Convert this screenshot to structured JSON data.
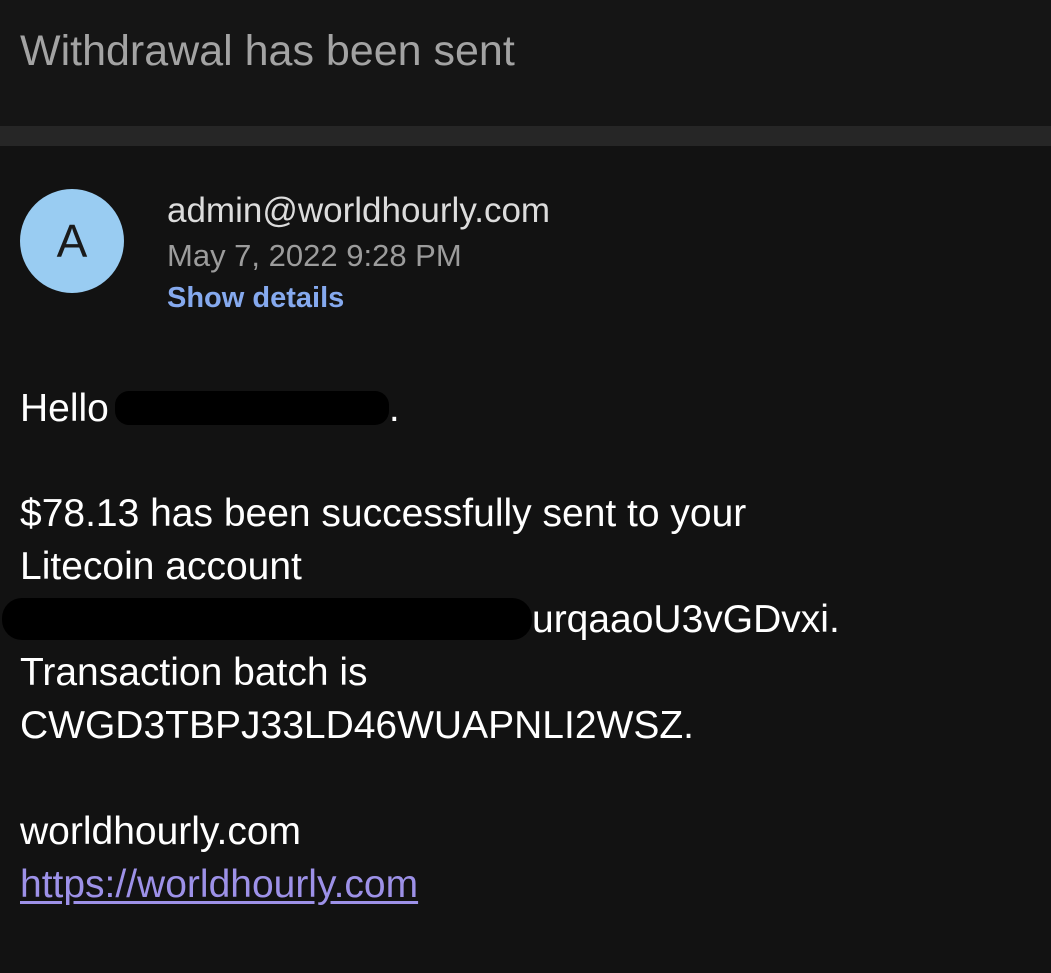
{
  "email": {
    "subject": "Withdrawal has been sent",
    "sender": {
      "avatar_letter": "A",
      "email": "admin@worldhourly.com",
      "date": "May 7, 2022 9:28 PM",
      "show_details_label": "Show details"
    },
    "body": {
      "greeting_prefix": "Hello",
      "greeting_suffix": ".",
      "line1": "$78.13 has been successfully sent to your",
      "line2": "Litecoin account",
      "address_visible_tail": "urqaaoU3vGDvxi.",
      "line4": "Transaction batch is",
      "line5": "CWGD3TBPJ33LD46WUAPNLI2WSZ.",
      "signature_site": "worldhourly.com",
      "signature_link": "https://worldhourly.com"
    }
  },
  "colors": {
    "background": "#121212",
    "subject_text": "#a3a3a3",
    "avatar_bg": "#99ccf2",
    "link_blue": "#85a9ee",
    "link_purple": "#9d91e8"
  }
}
